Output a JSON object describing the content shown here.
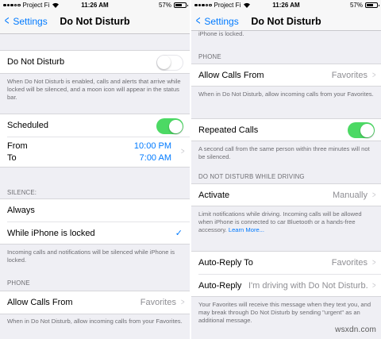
{
  "status_bar": {
    "carrier": "Project Fi",
    "time": "11:26 AM",
    "battery": "57%"
  },
  "nav": {
    "back_label": "Settings",
    "title": "Do Not Disturb"
  },
  "left": {
    "dnd_label": "Do Not Disturb",
    "dnd_on": false,
    "dnd_footer": "When Do Not Disturb is enabled, calls and alerts that arrive while locked will be silenced, and a moon icon will appear in the status bar.",
    "scheduled_label": "Scheduled",
    "scheduled_on": true,
    "from_label": "From",
    "to_label": "To",
    "from_time": "10:00 PM",
    "to_time": "7:00 AM",
    "silence_header": "SILENCE:",
    "always_label": "Always",
    "locked_label": "While iPhone is locked",
    "locked_footer": "Incoming calls and notifications will be silenced while iPhone is locked.",
    "phone_header": "PHONE",
    "allow_calls_label": "Allow Calls From",
    "allow_calls_value": "Favorites",
    "allow_calls_footer": "When in Do Not Disturb, allow incoming calls from your Favorites."
  },
  "right": {
    "top_partial": "iPhone is locked.",
    "phone_header": "PHONE",
    "allow_calls_label": "Allow Calls From",
    "allow_calls_value": "Favorites",
    "allow_calls_footer": "When in Do Not Disturb, allow incoming calls from your Favorites.",
    "repeated_label": "Repeated Calls",
    "repeated_on": true,
    "repeated_footer": "A second call from the same person within three minutes will not be silenced.",
    "driving_header": "DO NOT DISTURB WHILE DRIVING",
    "activate_label": "Activate",
    "activate_value": "Manually",
    "activate_footer": "Limit notifications while driving. Incoming calls will be allowed when iPhone is connected to car Bluetooth or a hands-free accessory.",
    "learn_more": "Learn More...",
    "auto_reply_to_label": "Auto-Reply To",
    "auto_reply_to_value": "Favorites",
    "auto_reply_label": "Auto-Reply",
    "auto_reply_value": "I'm driving with Do Not Disturb...",
    "auto_reply_footer": "Your Favorites will receive this message when they text you, and may break through Do Not Disturb by sending \"urgent\" as an additional message."
  },
  "watermark": "wsxdn.com",
  "colors": {
    "accent": "#007aff",
    "toggle_on": "#4cd964",
    "background": "#efeff4"
  },
  "icons": {
    "back": "chevron-left-icon",
    "disclosure": "chevron-right-icon",
    "check": "checkmark-icon",
    "wifi": "wifi-icon",
    "battery": "battery-icon"
  }
}
